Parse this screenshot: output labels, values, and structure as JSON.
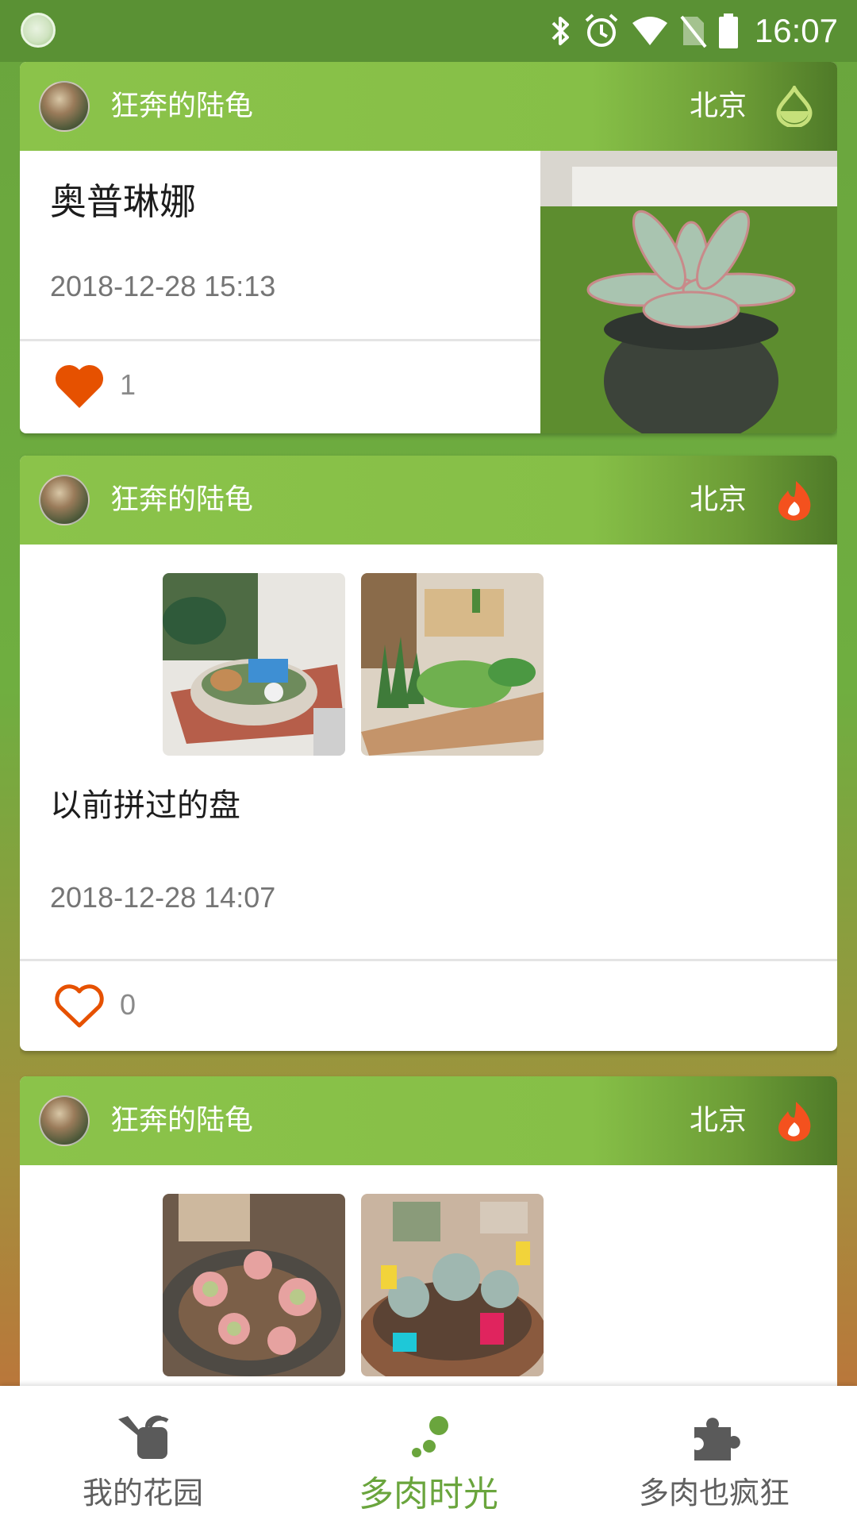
{
  "status_bar": {
    "time": "16:07"
  },
  "colors": {
    "accent": "#6aa53d",
    "like": "#e65100",
    "hot": "#f4511e",
    "water": "#9bc74a"
  },
  "feed": {
    "cards": [
      {
        "user": "狂奔的陆龟",
        "city": "北京",
        "status_icon": "water-drop-icon",
        "title": "奥普琳娜",
        "time": "2018-12-28 15:13",
        "likes": "1",
        "liked": true
      },
      {
        "user": "狂奔的陆龟",
        "city": "北京",
        "status_icon": "fire-icon",
        "title": "以前拼过的盘",
        "time": "2018-12-28 14:07",
        "likes": "0",
        "liked": false
      },
      {
        "user": "狂奔的陆龟",
        "city": "北京",
        "status_icon": "fire-icon"
      }
    ]
  },
  "bottom_nav": {
    "items": [
      {
        "label": "我的花园",
        "icon": "watering-can-icon"
      },
      {
        "label": "多肉时光",
        "icon": "dots-icon",
        "active": true
      },
      {
        "label": "多肉也疯狂",
        "icon": "puzzle-icon"
      }
    ]
  }
}
